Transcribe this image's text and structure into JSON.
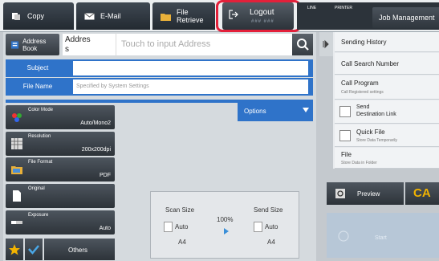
{
  "tabs": {
    "copy": "Copy",
    "email": "E-Mail",
    "file_retrieve": "File\nRetrieve"
  },
  "logout": {
    "label": "Logout",
    "user": "### ###"
  },
  "status": {
    "line": "LINE",
    "printer": "PRINTER"
  },
  "job_management": "Job Management",
  "address": {
    "book_label": "Address Book",
    "label": "Addres\ns",
    "placeholder": "Touch to input Address"
  },
  "subject": {
    "label": "Subject",
    "value": ""
  },
  "file_name": {
    "label": "File Name",
    "placeholder": "Specified by System Settings"
  },
  "options_label": "Options",
  "settings": [
    {
      "title": "Color Mode",
      "value": "Auto/Mono2"
    },
    {
      "title": "Resolution",
      "value": "200x200dpi"
    },
    {
      "title": "File Format",
      "value": "PDF"
    },
    {
      "title": "Original",
      "value": ""
    },
    {
      "title": "Exposure",
      "value": "Auto"
    }
  ],
  "others_label": "Others",
  "scan": {
    "scan_size_label": "Scan Size",
    "scan_auto": "Auto",
    "scan_paper": "A4",
    "ratio": "100%",
    "send_size_label": "Send Size",
    "send_auto": "Auto",
    "send_paper": "A4"
  },
  "right_panel": {
    "sending_history": "Sending History",
    "call_search_number": "Call Search Number",
    "call_program": "Call Program",
    "call_program_sub": "Call Registered settings",
    "send_destination_link": "Send\nDestination Link",
    "quick_file": "Quick File",
    "quick_file_sub": "Store Data Temporarily",
    "file": "File",
    "file_sub": "Store Data in Folder"
  },
  "preview_label": "Preview",
  "ca_label": "CA",
  "start_label": "Start",
  "colors": {
    "accent_blue": "#2f73c9",
    "highlight_red": "#e3203a",
    "ca_yellow": "#f2b300"
  }
}
